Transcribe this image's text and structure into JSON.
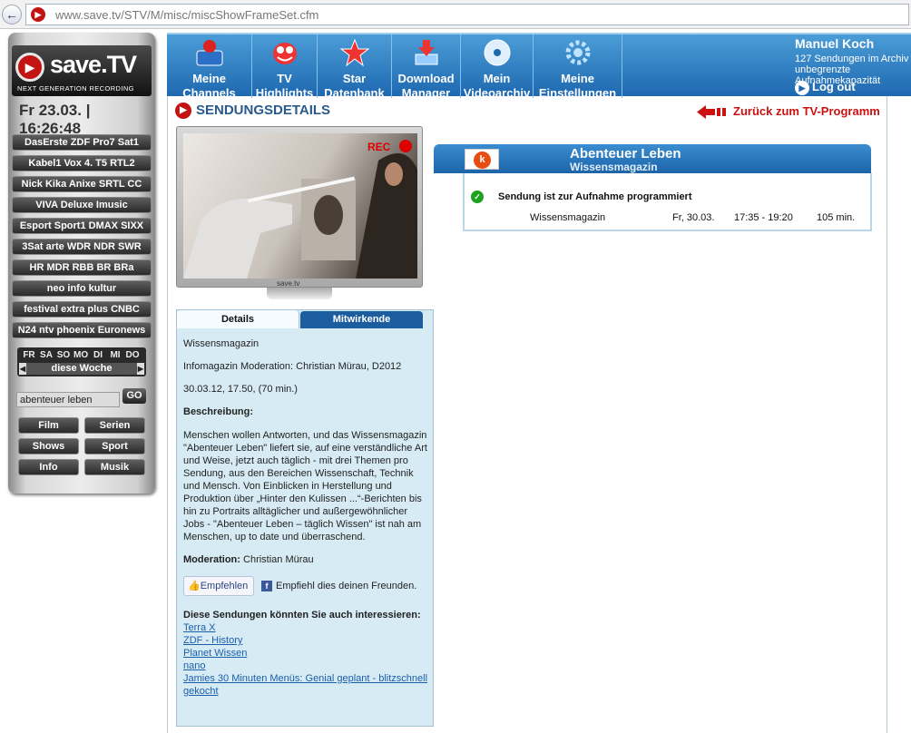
{
  "browser": {
    "url": "www.save.tv/STV/M/misc/miscShowFrameSet.cfm",
    "back_icon": "back-arrow-icon"
  },
  "sidebar": {
    "logo_text": "save.TV",
    "logo_subtitle": "NEXT GENERATION RECORDING",
    "clock": "Fr 23.03. | 16:26:48",
    "channel_groups": [
      "DasErste ZDF Pro7 Sat1",
      "Kabel1 Vox 4. T5 RTL2",
      "Nick Kika Anixe SRTL CC",
      "VIVA Deluxe Imusic",
      "Esport Sport1 DMAX SIXX",
      "3Sat arte WDR NDR SWR",
      "HR MDR RBB BR BRa",
      "neo info kultur",
      "festival extra plus CNBC",
      "N24 ntv phoenix Euronews"
    ],
    "days": [
      "FR",
      "SA",
      "SO",
      "MO",
      "DI",
      "MI",
      "DO"
    ],
    "week_label": "diese Woche",
    "search_value": "abenteuer leben",
    "go_label": "GO",
    "categories": [
      "Film",
      "Serien",
      "Shows",
      "Sport",
      "Info",
      "Musik"
    ]
  },
  "nav": {
    "items": [
      {
        "label": "Meine Channels",
        "icon": "person-icon"
      },
      {
        "label": "TV Highlights",
        "icon": "tv-mascot-icon"
      },
      {
        "label": "Star Datenbank",
        "icon": "star-icon"
      },
      {
        "label": "Download Manager",
        "icon": "download-icon"
      },
      {
        "label": "Mein Videoarchiv",
        "icon": "disc-icon"
      },
      {
        "label": "Meine Einstellungen",
        "icon": "gear-icon"
      }
    ],
    "user": {
      "name": "Manuel Koch",
      "line1": "127 Sendungen im Archiv",
      "line2": "unbegrenzte Aufnahmekapazität",
      "logout": "Log out"
    }
  },
  "content": {
    "section_title": "SENDUNGSDETAILS",
    "back_link": "Zurück zum TV-Programm",
    "tv": {
      "rec_label": "REC",
      "brand": "save.tv"
    },
    "tabs": [
      "Details",
      "Mitwirkende"
    ],
    "details": {
      "genre": "Wissensmagazin",
      "info": "Infomagazin Moderation: Christian Mürau, D2012",
      "airing": "30.03.12, 17.50, (70 min.)",
      "desc_label": "Beschreibung:",
      "description": "Menschen wollen Antworten, und das Wissensmagazin \"Abenteuer Leben\" liefert sie, auf eine verständliche Art und Weise, jetzt auch täglich - mit drei Themen pro Sendung, aus den Bereichen Wissenschaft, Technik und Mensch. Von Einblicken in Herstellung und Produktion über „Hinter den Kulissen ...“-Berichten bis hin zu Portraits alltäglicher und außergewöhnlicher Jobs - \"Abenteuer Leben – täglich Wissen\" ist nah am Menschen, up to date und überraschend.",
      "moderation_label": "Moderation:",
      "moderation_value": "Christian Mürau",
      "like_label": "Empfehlen",
      "share_text": "Empfiehl dies deinen Freunden.",
      "related_label": "Diese Sendungen könnten Sie auch interessieren:",
      "related": [
        "Terra X",
        "ZDF - History",
        "Planet Wissen",
        "nano",
        "Jamies 30 Minuten Menüs: Genial geplant - blitzschnell gekocht"
      ]
    },
    "program": {
      "title": "Abenteuer Leben",
      "subtitle": "Wissensmagazin",
      "status": "Sendung ist zur Aufnahme programmiert",
      "row": {
        "title": "Wissensmagazin",
        "date": "Fr, 30.03.",
        "time": "17:35 - 19:20",
        "duration": "105 min."
      }
    }
  },
  "colors": {
    "brand_red": "#c31313",
    "nav_blue": "#1e68b0",
    "link_blue": "#1a5faa"
  }
}
